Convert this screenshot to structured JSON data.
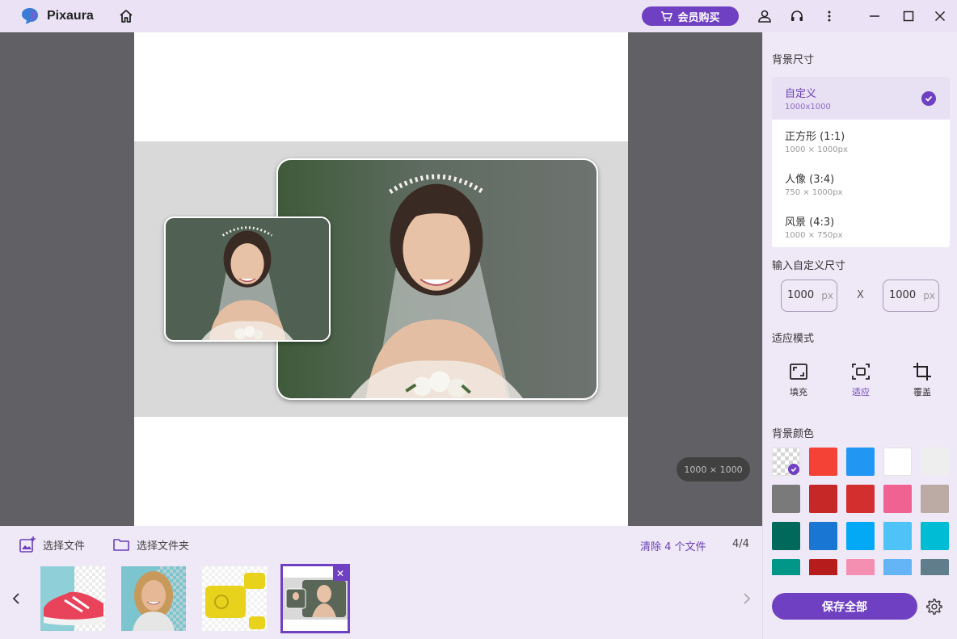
{
  "app": {
    "name": "Pixaura"
  },
  "titlebar": {
    "vip_label": "会员购买",
    "icons": [
      "logo-icon",
      "home-icon",
      "cart-icon",
      "user-icon",
      "headset-icon",
      "more-vertical-icon",
      "minimize-icon",
      "maximize-icon",
      "close-icon"
    ]
  },
  "canvas": {
    "size_label": "1000 × 1000"
  },
  "bottom": {
    "select_file": "选择文件",
    "select_folder": "选择文件夹",
    "clear": "清除 4 个文件",
    "counter": "4/4",
    "close_glyph": "✕"
  },
  "panel": {
    "bg_size_title": "背景尺寸",
    "sizes": [
      {
        "name": "自定义",
        "dim": "1000x1000",
        "selected": true
      },
      {
        "name": "正方形 (1:1)",
        "dim": "1000 × 1000px",
        "selected": false
      },
      {
        "name": "人像 (3:4)",
        "dim": "750 × 1000px",
        "selected": false
      },
      {
        "name": "风景 (4:3)",
        "dim": "1000 × 750px",
        "selected": false
      }
    ],
    "custom_size_title": "输入自定义尺寸",
    "width_value": "1000",
    "height_value": "1000",
    "unit": "px",
    "times": "X",
    "fit_mode_title": "适应模式",
    "fit_modes": [
      {
        "label": "填充",
        "icon": "fill-icon",
        "active": false
      },
      {
        "label": "适应",
        "icon": "fit-icon",
        "active": true
      },
      {
        "label": "覆盖",
        "icon": "crop-icon",
        "active": false
      }
    ],
    "bg_color_title": "背景颜色",
    "colors": [
      "transparent",
      "#f44336",
      "#2196f3",
      "#ffffff",
      "#eeeeee",
      "#7a7a7a",
      "#c62828",
      "#d32f2f",
      "#f06292",
      "#bcaaa4",
      "#00695c",
      "#1976d2",
      "#03a9f4",
      "#4fc3f7",
      "#00bcd4",
      "#009688",
      "#b71c1c",
      "#f48fb1",
      "#64b5f6",
      "#607d8b"
    ],
    "save_all": "保存全部"
  }
}
